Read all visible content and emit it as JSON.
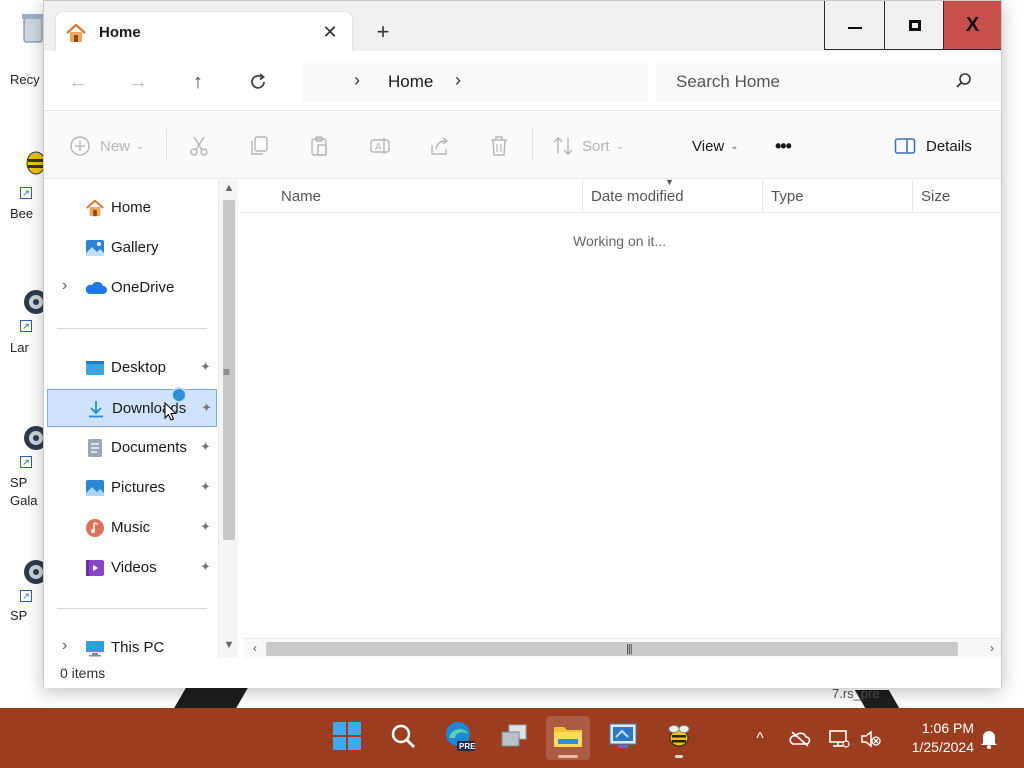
{
  "desktop": {
    "icon_labels": [
      "Recy",
      "Bee",
      "Lar",
      "SP Gala",
      "SP"
    ],
    "bottom_text": "7.rs_pre"
  },
  "window": {
    "tab": {
      "title": "Home",
      "close_glyph": "✕",
      "new_tab_glyph": "+"
    },
    "caption": {
      "minimize": "—",
      "close": "X"
    },
    "address": {
      "chevron": "›",
      "location": "Home",
      "trail": "›"
    },
    "search": {
      "placeholder": "Search Home"
    },
    "commands": {
      "new_label": "New",
      "sort_label": "Sort",
      "view_label": "View",
      "more_glyph": "•••",
      "details_label": "Details"
    },
    "nav_pane": {
      "top_items": [
        {
          "label": "Home",
          "icon": "home-icon"
        },
        {
          "label": "Gallery",
          "icon": "gallery-icon"
        },
        {
          "label": "OneDrive",
          "icon": "onedrive-icon",
          "expandable": true
        }
      ],
      "quick_access": [
        {
          "label": "Desktop",
          "icon": "desktop-folder-icon",
          "pinned": true
        },
        {
          "label": "Downloads",
          "icon": "downloads-icon",
          "pinned": true,
          "selected": true
        },
        {
          "label": "Documents",
          "icon": "documents-icon",
          "pinned": true
        },
        {
          "label": "Pictures",
          "icon": "pictures-icon",
          "pinned": true
        },
        {
          "label": "Music",
          "icon": "music-icon",
          "pinned": true
        },
        {
          "label": "Videos",
          "icon": "videos-icon",
          "pinned": true
        }
      ],
      "this_pc": {
        "label": "This PC",
        "icon": "this-pc-icon",
        "expandable": true
      },
      "pin_glyph": "📌"
    },
    "columns": [
      "Name",
      "Date modified",
      "Type",
      "Size"
    ],
    "sort_column": "Date modified",
    "content_message": "Working on it...",
    "status": "0 items"
  },
  "taskbar": {
    "apps": [
      {
        "name": "Start",
        "icon": "windows-logo-icon"
      },
      {
        "name": "Search",
        "icon": "search-icon"
      },
      {
        "name": "Edge Preview",
        "icon": "edge-pre-icon",
        "badge": "PRE"
      },
      {
        "name": "Task View",
        "icon": "task-view-icon"
      },
      {
        "name": "File Explorer",
        "icon": "file-explorer-icon",
        "active": true
      },
      {
        "name": "Remote Desktop",
        "icon": "remote-desktop-icon"
      },
      {
        "name": "Bee app",
        "icon": "bee-icon",
        "running": true
      }
    ],
    "tray": {
      "chevron": "^",
      "time": "1:06 PM",
      "date": "1/25/2024"
    }
  },
  "colors": {
    "taskbar": "#9c3d1f",
    "close_button": "#c8504b",
    "selection": "#cfe3fb",
    "accent": "#0067c0"
  }
}
